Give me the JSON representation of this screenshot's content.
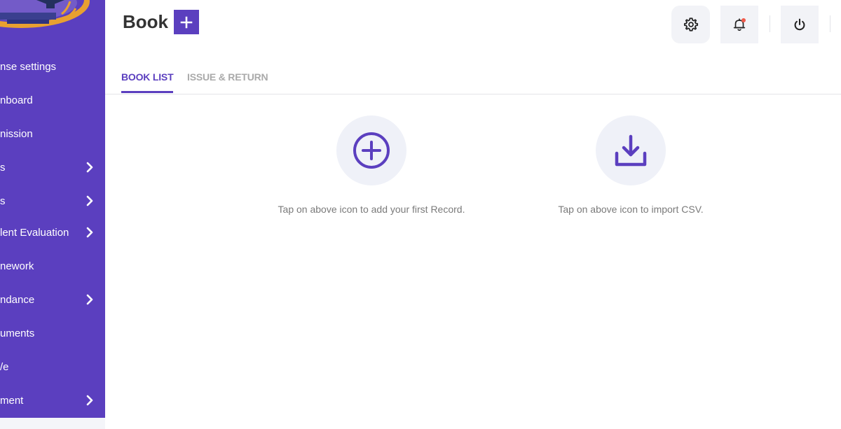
{
  "sidebar": {
    "items": [
      {
        "label": "nse settings",
        "has_chevron": false
      },
      {
        "label": "nboard",
        "has_chevron": false
      },
      {
        "label": "nission",
        "has_chevron": false
      },
      {
        "label": "s",
        "has_chevron": true
      },
      {
        "label": "s",
        "has_chevron": true
      },
      {
        "label": "lent Evaluation",
        "has_chevron": true
      },
      {
        "label": "nework",
        "has_chevron": false
      },
      {
        "label": "ndance",
        "has_chevron": true
      },
      {
        "label": "uments",
        "has_chevron": false
      },
      {
        "label": "/e",
        "has_chevron": false
      },
      {
        "label": "ment",
        "has_chevron": true
      }
    ]
  },
  "header": {
    "title": "Book",
    "add_icon": "plus-icon",
    "actions": [
      "gear-icon",
      "bell-icon",
      "power-icon"
    ]
  },
  "tabs": [
    {
      "label": "BOOK LIST",
      "active": true
    },
    {
      "label": "ISSUE & RETURN",
      "active": false
    }
  ],
  "empty_state": {
    "add": {
      "icon": "plus-circle-icon",
      "hint": "Tap on above icon to add your first Record."
    },
    "import": {
      "icon": "download-icon",
      "hint": "Tap on above icon to import CSV."
    }
  },
  "colors": {
    "accent": "#5b3fbf",
    "sidebar_bg": "#5b3fbf",
    "icon_bg": "#eff1f8",
    "notification_dot": "#f05a4a",
    "logo_gold": "#e8a030"
  }
}
